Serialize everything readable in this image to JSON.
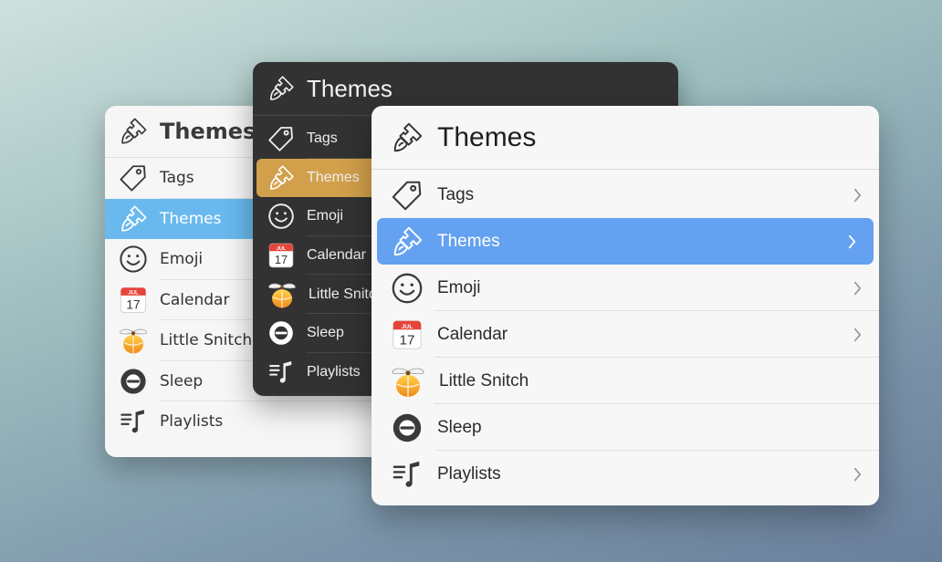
{
  "colors": {
    "light_selection": "#69b9ee",
    "dark_selection": "#d2a04b",
    "front_selection": "#64a1f0",
    "dark_panel": "#323232"
  },
  "left_panel": {
    "title": "Themes",
    "title_icon": "paintbrush-icon",
    "items": [
      {
        "label": "Tags",
        "icon": "tag-icon"
      },
      {
        "label": "Themes",
        "icon": "paintbrush-icon",
        "selected": true
      },
      {
        "label": "Emoji",
        "icon": "smiley-icon"
      },
      {
        "label": "Calendar",
        "icon": "calendar-icon"
      },
      {
        "label": "Little Snitch",
        "icon": "little-snitch-icon"
      },
      {
        "label": "Sleep",
        "icon": "sleep-icon"
      },
      {
        "label": "Playlists",
        "icon": "playlist-icon"
      }
    ]
  },
  "middle_panel": {
    "title": "Themes",
    "title_icon": "paintbrush-icon",
    "items": [
      {
        "label": "Tags",
        "icon": "tag-icon"
      },
      {
        "label": "Themes",
        "icon": "paintbrush-icon",
        "selected": true
      },
      {
        "label": "Emoji",
        "icon": "smiley-icon"
      },
      {
        "label": "Calendar",
        "icon": "calendar-icon"
      },
      {
        "label": "Little Snitch",
        "icon": "little-snitch-icon"
      },
      {
        "label": "Sleep",
        "icon": "sleep-icon"
      },
      {
        "label": "Playlists",
        "icon": "playlist-icon"
      }
    ]
  },
  "right_panel": {
    "title": "Themes",
    "title_icon": "paintbrush-icon",
    "items": [
      {
        "label": "Tags",
        "icon": "tag-icon",
        "chevron": true
      },
      {
        "label": "Themes",
        "icon": "paintbrush-icon",
        "chevron": true,
        "selected": true
      },
      {
        "label": "Emoji",
        "icon": "smiley-icon",
        "chevron": true
      },
      {
        "label": "Calendar",
        "icon": "calendar-icon",
        "chevron": true
      },
      {
        "label": "Little Snitch",
        "icon": "little-snitch-icon",
        "chevron": false
      },
      {
        "label": "Sleep",
        "icon": "sleep-icon",
        "chevron": false
      },
      {
        "label": "Playlists",
        "icon": "playlist-icon",
        "chevron": true
      }
    ]
  },
  "calendar_icon": {
    "month": "JUL",
    "day": "17"
  }
}
